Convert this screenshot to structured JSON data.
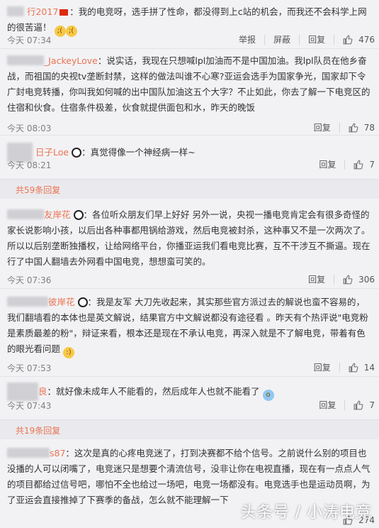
{
  "comments": [
    {
      "user": "行2017",
      "text": "：我的电竞呀，选手拼了性命，都没得到上c站的机会，而我还不会科学上网的很苦逼！",
      "time": "今天 07:34",
      "actions": [
        "举报",
        "屏蔽",
        "回复"
      ],
      "likes": "476"
    },
    {
      "user": "_JackeyLove",
      "text": "：说实话，我现在只想喊lpl加油而不是中国加油。我lpl队员在他乡奋战，而祖国的央视tv垄断封禁，这样的做法叫谁不心寒?亚运会选手为国家争光，国家却下令广封电竞转播，你叫我如何喊的出中国队加油这五个大字？不止如此，你去了解一下电竞区的住宿和伙食。住宿条件极差，伙食就提供面包和水，昨天的晚饭",
      "time": "今天 08:03",
      "actions": [
        "回复"
      ],
      "likes": "78"
    },
    {
      "user": "日子Loe",
      "text": "：真觉得像一个神经病一样~",
      "time": "今天 08:21",
      "actions": [
        "回复"
      ],
      "likes": "7"
    },
    {
      "user": "友岸花",
      "text": "：各位听众朋友们早上好好 另外一说，央视一播电竞肯定会有很多奇怪的家长说影响小孩，以后出各种事都甩锅给游戏，然后电竞被封杀，这种事又不是一次两次了。所以以后别垄断独播权，让给网络平台，你播亚运我们看电竞比赛，互不干涉互不撕逼。现在行了中国人翻墙去外网看中国电竞，想想蛮可笑的。",
      "time": "今天 07:36",
      "actions": [
        "回复"
      ],
      "likes": "306"
    },
    {
      "user": "彼岸花",
      "text": "：我是友军 大刀先收起来，其实那些官方派过去的解说也蛮不容易的，我们翻墙看的本体也是英文解说，结果官方中文解说都没有途径看 。昨天有个热评说\"电竞粉是素质最差的粉\"，辩证来看，根本还是现在不承认电竞，再深入就是不了解电竞，带着有色的眼光看问题",
      "time": "今天 07:53",
      "actions": [
        "回复"
      ],
      "likes": "14"
    },
    {
      "user": "良",
      "text": "：就好像未成年人不能看的，然后成年人也就不能看了",
      "time": "今天 07:43",
      "actions": [
        "回复"
      ],
      "likes": "7"
    },
    {
      "user": "s87",
      "text": "：这次是真的心疼电竞迷了，打到决赛都不给个信号。之前说什么别的项目也没播的人可以闭嘴了，电竞迷只是想要个清流信号，没非让你在电视直播，现在有一点点人气的项目都给过信号吧，哪怕不全也给过一场吧，电竞一场都没有。电竞选手也是运动员啊，为了亚运会直接推掉了下赛季的备战，怎么就不能理解一下",
      "time": "",
      "actions": [],
      "likes": "274"
    }
  ],
  "more_replies": [
    "共59条回复",
    "共19条回复"
  ],
  "watermark": "头条号 / 小涛电竞"
}
